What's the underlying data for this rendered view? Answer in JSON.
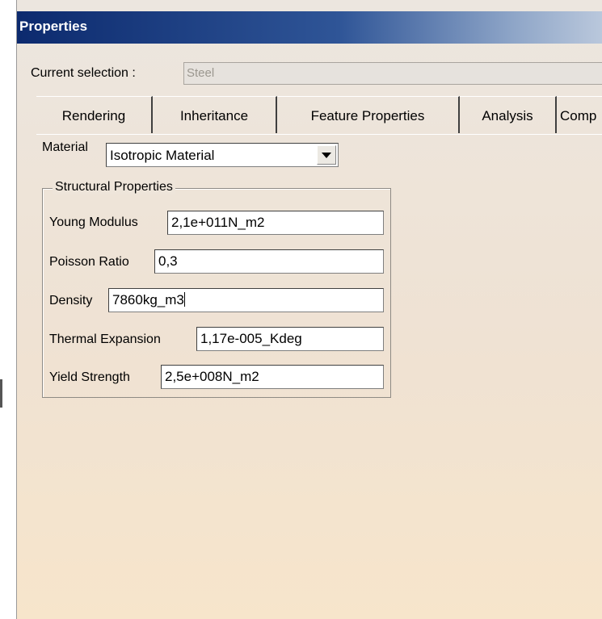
{
  "window": {
    "title": "Properties"
  },
  "selection": {
    "label": "Current selection :",
    "value": "Steel"
  },
  "tabs": [
    {
      "label": "Rendering",
      "active": false
    },
    {
      "label": "Inheritance",
      "active": false
    },
    {
      "label": "Feature Properties",
      "active": false
    },
    {
      "label": "Analysis",
      "active": true
    },
    {
      "label": "Comp",
      "active": false
    }
  ],
  "material": {
    "label": "Material",
    "value": "Isotropic Material"
  },
  "structural": {
    "title": "Structural Properties",
    "young_modulus": {
      "label": "Young Modulus",
      "value": "2,1e+011N_m2"
    },
    "poisson_ratio": {
      "label": "Poisson Ratio",
      "value": "0,3"
    },
    "density": {
      "label": "Density",
      "value": "7860kg_m3"
    },
    "thermal_expansion": {
      "label": "Thermal Expansion",
      "value": "1,17e-005_Kdeg"
    },
    "yield_strength": {
      "label": "Yield Strength",
      "value": "2,5e+008N_m2"
    }
  },
  "colors": {
    "titlebar_start": "#0c2a6e",
    "titlebar_end": "#bac8dc"
  }
}
